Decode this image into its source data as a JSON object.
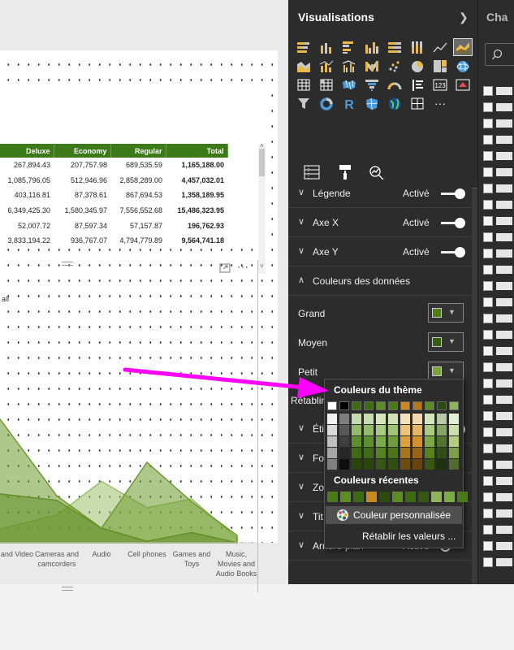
{
  "table": {
    "headers": [
      "Deluxe",
      "Economy",
      "Regular",
      "Total"
    ],
    "rows": [
      [
        "267,894.43",
        "207,757.98",
        "689,535.59",
        "1,165,188.00"
      ],
      [
        "1,085,796.05",
        "512,946.96",
        "2,858,289.00",
        "4,457,032.01"
      ],
      [
        "403,116.81",
        "87,378.61",
        "867,694.53",
        "1,358,189.95"
      ],
      [
        "6,349,425.30",
        "1,580,345.97",
        "7,556,552.68",
        "15,486,323.95"
      ],
      [
        "52,007.72",
        "87,597.34",
        "57,157.87",
        "196,762.93"
      ],
      [
        "3,833,194.22",
        "936,767.07",
        "4,794,779.89",
        "9,564,741.18"
      ]
    ]
  },
  "chart": {
    "legend_fragment": "all",
    "x_labels": [
      "TV and Video",
      "Cameras and camcorders",
      "Audio",
      "Cell phones",
      "Games and Toys",
      "Music, Movies and Audio Books"
    ]
  },
  "chart_data": {
    "type": "area",
    "categories": [
      "TV and Video",
      "Cameras and camcorders",
      "Audio",
      "Cell phones",
      "Games and Toys",
      "Music, Movies and Audio Books"
    ],
    "series": [
      {
        "color": "#9cbf6a",
        "values": [
          0.08,
          0.19,
          0.42,
          0.24,
          0.3,
          0.03
        ]
      },
      {
        "color": "#5a7f1e",
        "values": [
          0.34,
          0.29,
          0.1,
          0.01,
          0.07,
          0.0
        ]
      },
      {
        "color": "#6c9a2e",
        "values": [
          0.92,
          0.32,
          0.1,
          0.55,
          0.28,
          0.05
        ]
      }
    ]
  },
  "visualizations": {
    "title": "Visualisations",
    "icons": [
      "stacked-bar-icon",
      "stacked-column-icon",
      "clustered-bar-icon",
      "clustered-column-icon",
      "100-bar-icon",
      "100-column-icon",
      "line-chart-icon",
      "area-chart-icon",
      "stacked-area-icon",
      "line-column-icon",
      "line-clustered-column-icon",
      "ribbon-chart-icon",
      "scatter-chart-icon",
      "pie-chart-icon",
      "treemap-icon",
      "map-icon",
      "table-icon",
      "matrix-icon",
      "filled-map-icon",
      "funnel-icon",
      "gauge-icon",
      "multirow-card-icon",
      "card-icon",
      "kpi-icon",
      "slicer-icon",
      "donut-icon",
      "r-visual-icon",
      "shape-map-icon",
      "globe-icon",
      "grid-icon",
      "more-icon"
    ],
    "r_glyph": "R",
    "card_glyph": "123",
    "more_glyph": "···",
    "sections": [
      {
        "label": "Légende",
        "state": "Activé",
        "toggle": "on"
      },
      {
        "label": "Axe X",
        "state": "Activé",
        "toggle": "on"
      },
      {
        "label": "Axe Y",
        "state": "Activé",
        "toggle": "on"
      },
      {
        "label": "Couleurs des données",
        "state": "",
        "toggle": "none"
      }
    ],
    "color_rows": [
      {
        "label": "Grand",
        "color": "#4e7f16"
      },
      {
        "label": "Moyen",
        "color": "#375d10"
      },
      {
        "label": "Petit",
        "color": "#7ba33c"
      }
    ],
    "lower_sections": [
      {
        "label": "Éti",
        "state": "",
        "toggle": "on"
      },
      {
        "label": "Fo",
        "state": "",
        "toggle": "none"
      },
      {
        "label": "Zo",
        "state": "",
        "toggle": "none"
      },
      {
        "label": "Tit",
        "state": "",
        "toggle": "none"
      },
      {
        "label": "Arrière-plan",
        "state": "Activé",
        "toggle": "off"
      }
    ],
    "partial_label": "Rétablir"
  },
  "fields": {
    "title": "Cha"
  },
  "picker": {
    "theme_title": "Couleurs du thème",
    "recent_title": "Couleurs récentes",
    "custom_label": "Couleur personnalisée",
    "reset_label": "Rétablir les valeurs ...",
    "theme_top": [
      "#ffffff",
      "#000000",
      "#3d6b12",
      "#3d6b12",
      "#5a8d24",
      "#4b7a18",
      "#c88a1e",
      "#b5781a",
      "#5a8d24",
      "#2c4a10",
      "#8fb35a"
    ],
    "theme_shades": [
      [
        "#f2f2f2",
        "#d9d9d9",
        "#bfbfbf",
        "#a6a6a6",
        "#7f7f7f"
      ],
      [
        "#7f7f7f",
        "#595959",
        "#3f3f3f",
        "#262626",
        "#0d0d0d"
      ],
      [
        "#c5dcb0",
        "#94ba6d",
        "#5d8f2d",
        "#3f6a17",
        "#28460d"
      ],
      [
        "#c5dcb0",
        "#94ba6d",
        "#5d8f2d",
        "#3f6a17",
        "#28460d"
      ],
      [
        "#d3e6bc",
        "#a9cc82",
        "#7aab46",
        "#55821f",
        "#375614"
      ],
      [
        "#cfe2b8",
        "#a1c478",
        "#6f9d39",
        "#4a7619",
        "#304e10"
      ],
      [
        "#f5e1bc",
        "#ebc47c",
        "#dca33c",
        "#a8761a",
        "#6d4d11"
      ],
      [
        "#f2d9b2",
        "#e5b569",
        "#d3922a",
        "#996415",
        "#65420e"
      ],
      [
        "#d3e6bc",
        "#a9cc82",
        "#7aab46",
        "#55821f",
        "#375614"
      ],
      [
        "#b9c9a8",
        "#87a46a",
        "#52722f",
        "#334d16",
        "#1f300d"
      ],
      [
        "#e4eed4",
        "#cddfad",
        "#b3cd82",
        "#7e9f4a",
        "#52692f"
      ]
    ],
    "recent": [
      "#4b7a18",
      "#5a8d24",
      "#3d6b12",
      "#c88a1e",
      "#2c4a10",
      "#5a8d24",
      "#3d6b12",
      "#375614",
      "#8fb35a",
      "#7aab46",
      "#4b7a18"
    ]
  }
}
